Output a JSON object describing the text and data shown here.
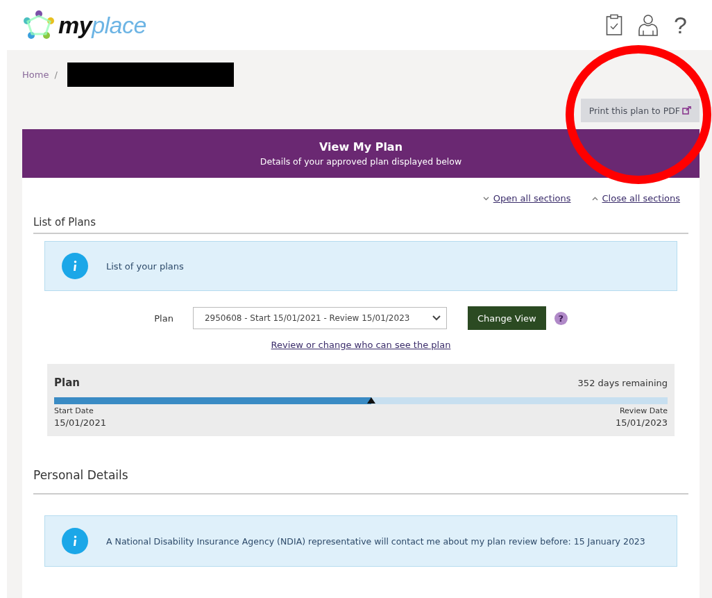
{
  "header": {
    "logo": "**my**place",
    "help": "?"
  },
  "breadcrumb": {
    "home": "Home",
    "separator": "/",
    "redacted": true
  },
  "print_button": {
    "label": "Print this plan to PDF"
  },
  "banner": {
    "title": "View My Plan",
    "subtitle": "Details of your approved plan displayed below"
  },
  "section_controls": [
    "Open all sections",
    "Close all sections"
  ],
  "sections": [
    {
      "title": "List of Plans",
      "info": "List of your plans",
      "plan_select": {
        "label": "Plan",
        "value": "2950608 - Start 15/01/2021 - Review 15/01/2023"
      },
      "button": "Change View",
      "help": "?",
      "link": "Review or change who can see the plan",
      "timeline": {
        "title": "Plan",
        "remaining": "352 days remaining",
        "level": 0.517,
        "start_label": "Start Date",
        "start": "15/01/2021",
        "end_label": "Review Date",
        "end": "15/01/2023"
      }
    },
    {
      "title": "Personal Details",
      "info": "A National Disability Insurance Agency (NDIA) representative will contact me about my plan review before: 15 January 2023"
    }
  ],
  "annotation": {
    "kind": "circle",
    "color": "#ff0000"
  }
}
